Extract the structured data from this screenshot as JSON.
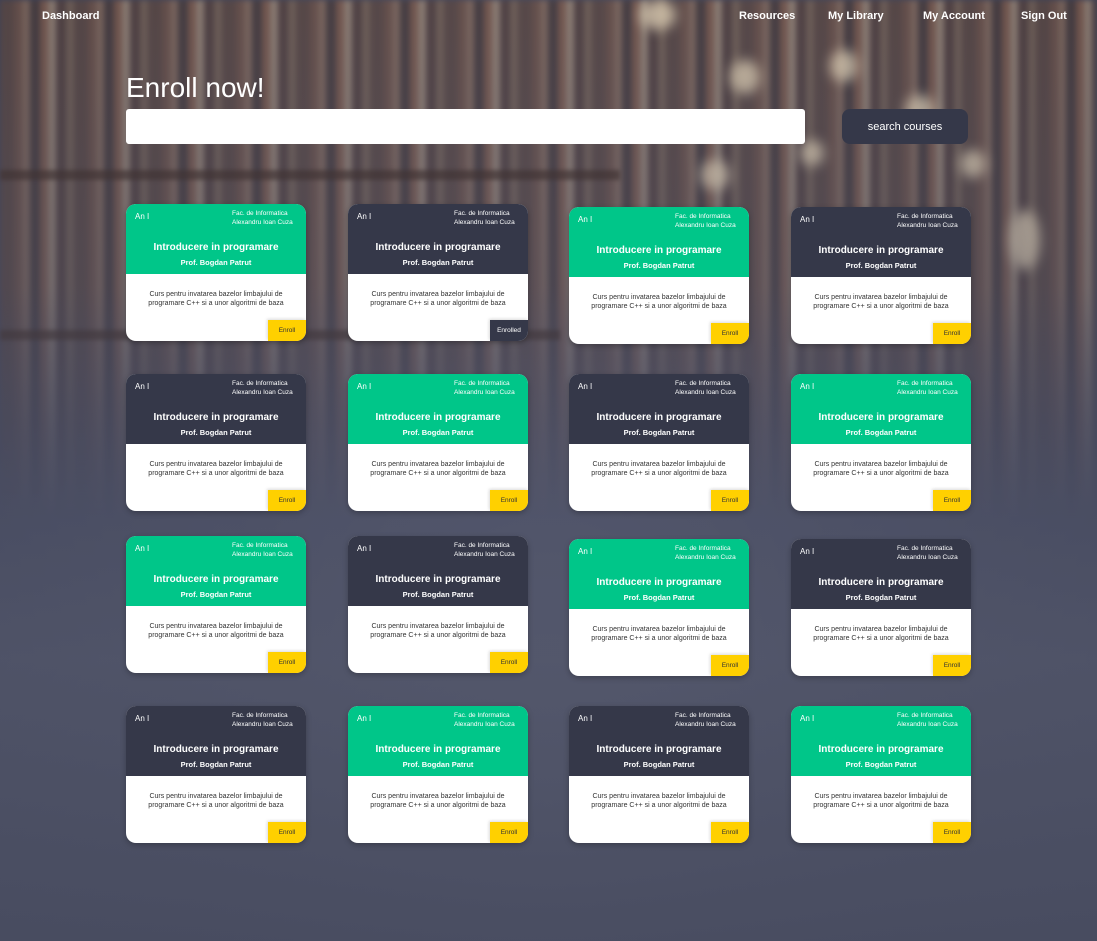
{
  "nav": {
    "dashboard": "Dashboard",
    "resources": "Resources",
    "my_library": "My Library",
    "my_account": "My Account",
    "sign_out": "Sign Out"
  },
  "hero": {
    "title": "Enroll now!",
    "search_value": "",
    "search_button": "search courses"
  },
  "colors": {
    "green": "#00c689",
    "dark": "#353849",
    "enroll_yellow": "#ffd000"
  },
  "courses": [
    {
      "theme": "green",
      "year": "An I",
      "fac_line1": "Fac. de Informatica",
      "fac_line2": "Alexandru  Ioan Cuza",
      "title": "Introducere in programare",
      "prof": "Prof. Bogdan Patrut",
      "desc": "Curs pentru invatarea bazelor limbajului de programare C++ si a unor algoritmi de baza",
      "action": "Enroll",
      "enrolled": false
    },
    {
      "theme": "dark",
      "year": "An I",
      "fac_line1": "Fac. de Informatica",
      "fac_line2": "Alexandru  Ioan Cuza",
      "title": "Introducere in programare",
      "prof": "Prof. Bogdan Patrut",
      "desc": "Curs pentru invatarea bazelor limbajului de programare C++ si a unor algoritmi de baza",
      "action": "Enrolled",
      "enrolled": true
    },
    {
      "theme": "green",
      "year": "An I",
      "fac_line1": "Fac. de Informatica",
      "fac_line2": "Alexandru  Ioan Cuza",
      "title": "Introducere in programare",
      "prof": "Prof. Bogdan Patrut",
      "desc": "Curs pentru invatarea bazelor limbajului de programare C++ si a unor algoritmi de baza",
      "action": "Enroll",
      "enrolled": false
    },
    {
      "theme": "dark",
      "year": "An I",
      "fac_line1": "Fac. de Informatica",
      "fac_line2": "Alexandru  Ioan Cuza",
      "title": "Introducere in programare",
      "prof": "Prof. Bogdan Patrut",
      "desc": "Curs pentru invatarea bazelor limbajului de programare C++ si a unor algoritmi de baza",
      "action": "Enroll",
      "enrolled": false
    },
    {
      "theme": "dark",
      "year": "An I",
      "fac_line1": "Fac. de Informatica",
      "fac_line2": "Alexandru  Ioan Cuza",
      "title": "Introducere in programare",
      "prof": "Prof. Bogdan Patrut",
      "desc": "Curs pentru invatarea bazelor limbajului de programare C++ si a unor algoritmi de baza",
      "action": "Enroll",
      "enrolled": false
    },
    {
      "theme": "green",
      "year": "An I",
      "fac_line1": "Fac. de Informatica",
      "fac_line2": "Alexandru  Ioan Cuza",
      "title": "Introducere in programare",
      "prof": "Prof. Bogdan Patrut",
      "desc": "Curs pentru invatarea bazelor limbajului de programare C++ si a unor algoritmi de baza",
      "action": "Enroll",
      "enrolled": false
    },
    {
      "theme": "dark",
      "year": "An I",
      "fac_line1": "Fac. de Informatica",
      "fac_line2": "Alexandru  Ioan Cuza",
      "title": "Introducere in programare",
      "prof": "Prof. Bogdan Patrut",
      "desc": "Curs pentru invatarea bazelor limbajului de programare C++ si a unor algoritmi de baza",
      "action": "Enroll",
      "enrolled": false
    },
    {
      "theme": "green",
      "year": "An I",
      "fac_line1": "Fac. de Informatica",
      "fac_line2": "Alexandru  Ioan Cuza",
      "title": "Introducere in programare",
      "prof": "Prof. Bogdan Patrut",
      "desc": "Curs pentru invatarea bazelor limbajului de programare C++ si a unor algoritmi de baza",
      "action": "Enroll",
      "enrolled": false
    },
    {
      "theme": "green",
      "year": "An I",
      "fac_line1": "Fac. de Informatica",
      "fac_line2": "Alexandru  Ioan Cuza",
      "title": "Introducere in programare",
      "prof": "Prof. Bogdan Patrut",
      "desc": "Curs pentru invatarea bazelor limbajului de programare C++ si a unor algoritmi de baza",
      "action": "Enroll",
      "enrolled": false
    },
    {
      "theme": "dark",
      "year": "An I",
      "fac_line1": "Fac. de Informatica",
      "fac_line2": "Alexandru  Ioan Cuza",
      "title": "Introducere in programare",
      "prof": "Prof. Bogdan Patrut",
      "desc": "Curs pentru invatarea bazelor limbajului de programare C++ si a unor algoritmi de baza",
      "action": "Enroll",
      "enrolled": false
    },
    {
      "theme": "green",
      "year": "An I",
      "fac_line1": "Fac. de Informatica",
      "fac_line2": "Alexandru  Ioan Cuza",
      "title": "Introducere in programare",
      "prof": "Prof. Bogdan Patrut",
      "desc": "Curs pentru invatarea bazelor limbajului de programare C++ si a unor algoritmi de baza",
      "action": "Enroll",
      "enrolled": false
    },
    {
      "theme": "dark",
      "year": "An I",
      "fac_line1": "Fac. de Informatica",
      "fac_line2": "Alexandru  Ioan Cuza",
      "title": "Introducere in programare",
      "prof": "Prof. Bogdan Patrut",
      "desc": "Curs pentru invatarea bazelor limbajului de programare C++ si a unor algoritmi de baza",
      "action": "Enroll",
      "enrolled": false
    },
    {
      "theme": "dark",
      "year": "An I",
      "fac_line1": "Fac. de Informatica",
      "fac_line2": "Alexandru  Ioan Cuza",
      "title": "Introducere in programare",
      "prof": "Prof. Bogdan Patrut",
      "desc": "Curs pentru invatarea bazelor limbajului de programare C++ si a unor algoritmi de baza",
      "action": "Enroll",
      "enrolled": false
    },
    {
      "theme": "green",
      "year": "An I",
      "fac_line1": "Fac. de Informatica",
      "fac_line2": "Alexandru  Ioan Cuza",
      "title": "Introducere in programare",
      "prof": "Prof. Bogdan Patrut",
      "desc": "Curs pentru invatarea bazelor limbajului de programare C++ si a unor algoritmi de baza",
      "action": "Enroll",
      "enrolled": false
    },
    {
      "theme": "dark",
      "year": "An I",
      "fac_line1": "Fac. de Informatica",
      "fac_line2": "Alexandru  Ioan Cuza",
      "title": "Introducere in programare",
      "prof": "Prof. Bogdan Patrut",
      "desc": "Curs pentru invatarea bazelor limbajului de programare C++ si a unor algoritmi de baza",
      "action": "Enroll",
      "enrolled": false
    },
    {
      "theme": "green",
      "year": "An I",
      "fac_line1": "Fac. de Informatica",
      "fac_line2": "Alexandru  Ioan Cuza",
      "title": "Introducere in programare",
      "prof": "Prof. Bogdan Patrut",
      "desc": "Curs pentru invatarea bazelor limbajului de programare C++ si a unor algoritmi de baza",
      "action": "Enroll",
      "enrolled": false
    }
  ]
}
